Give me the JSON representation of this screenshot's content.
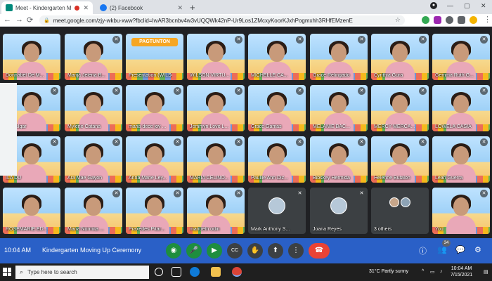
{
  "browser": {
    "tabs": [
      {
        "title": "Meet - Kindergarten Moving",
        "favicon_color": "#00897b",
        "recording": true
      },
      {
        "title": "(2) Facebook",
        "favicon_color": "#1877f2",
        "recording": false
      }
    ],
    "new_tab": "+",
    "window_buttons": {
      "minimize": "—",
      "maximize": "▢",
      "close": "✕"
    },
    "nav": {
      "back": "←",
      "forward": "→",
      "reload": "⟳"
    },
    "url": "meet.google.com/zjy-wkbu-xww?fbclid=IwAR3bcnbv4w3vUQQWk42nP-Ur9Los1ZMcxyKoorKJxhPogmxhh3RHfEMzenE",
    "lock": "🔒",
    "bookmark": "☆"
  },
  "tiles": [
    {
      "name": "Donnabel De M...",
      "muted": false
    },
    {
      "name": "Marija Jelena B...",
      "muted": true
    },
    {
      "name": "Presentation (WILSON VIRTU...",
      "muted": false
    },
    {
      "name": "WILSON VIRTU...",
      "muted": true
    },
    {
      "name": "MICHELLE CA...",
      "muted": true
    },
    {
      "name": "Grace Relingado",
      "muted": true
    },
    {
      "name": "Cynthia Gura",
      "muted": true
    },
    {
      "name": "Gemma Ruth G...",
      "muted": true
    },
    {
      "name": "an Fulgar",
      "muted": true
    },
    {
      "name": "Mylene Catana",
      "muted": true
    },
    {
      "name": "maria dece joy ...",
      "muted": true
    },
    {
      "name": "Jemmyn Love L...",
      "muted": true
    },
    {
      "name": "Grace Gamas",
      "muted": true
    },
    {
      "name": "MELANIE BAC...",
      "muted": true
    },
    {
      "name": "MERCY MERCA...",
      "muted": true
    },
    {
      "name": "LOWELA CASIA",
      "muted": true
    },
    {
      "name": "ILA DU",
      "muted": true
    },
    {
      "name": "Ara Mae Gayon",
      "muted": true
    },
    {
      "name": "Anna Marie Ley...",
      "muted": true
    },
    {
      "name": "MARIA CELINO...",
      "muted": true
    },
    {
      "name": "Paullie Ann Diz...",
      "muted": true
    },
    {
      "name": "Bibskey Hermida",
      "muted": true
    },
    {
      "name": "Helenne Butalon",
      "muted": true
    },
    {
      "name": "Leah Guerra",
      "muted": true
    },
    {
      "name": "ROSEMARIE ED...",
      "muted": false
    },
    {
      "name": "Maria Normita ...",
      "muted": true
    },
    {
      "name": "Praxedes Pitar...",
      "muted": true
    },
    {
      "name": "maribeth odin",
      "muted": true
    },
    {
      "name": "Mark Anthony S...",
      "muted": true
    },
    {
      "name": "Joana Reyes",
      "muted": true
    },
    {
      "name": "3 others",
      "muted": false
    },
    {
      "name": "You",
      "muted": true
    }
  ],
  "slide_title": "PAGTUNTON",
  "meeting": {
    "time": "10:04 AM",
    "title": "Kindergarten Moving Up Ceremony",
    "participant_count": "34"
  },
  "controls": {
    "audio_icon": "◉",
    "mic_icon": "🎤",
    "camera_icon": "▶",
    "captions_icon": "CC",
    "raise_hand_icon": "✋",
    "present_icon": "⬆",
    "more_icon": "⋮",
    "end_call_icon": "☎",
    "info_icon": "ⓘ",
    "people_icon": "👥",
    "chat_icon": "💬",
    "activities_icon": "⚙"
  },
  "taskbar": {
    "search_placeholder": "Type here to search",
    "search_icon": "⌕",
    "weather": "31°C  Partly sunny",
    "tray_arrow": "^",
    "clock_time": "10:04 AM",
    "clock_date": "7/15/2021"
  },
  "colors": {
    "meet_bar": "#2a60c7",
    "end_call": "#ea4335",
    "active_green": "#1e8e3e"
  }
}
